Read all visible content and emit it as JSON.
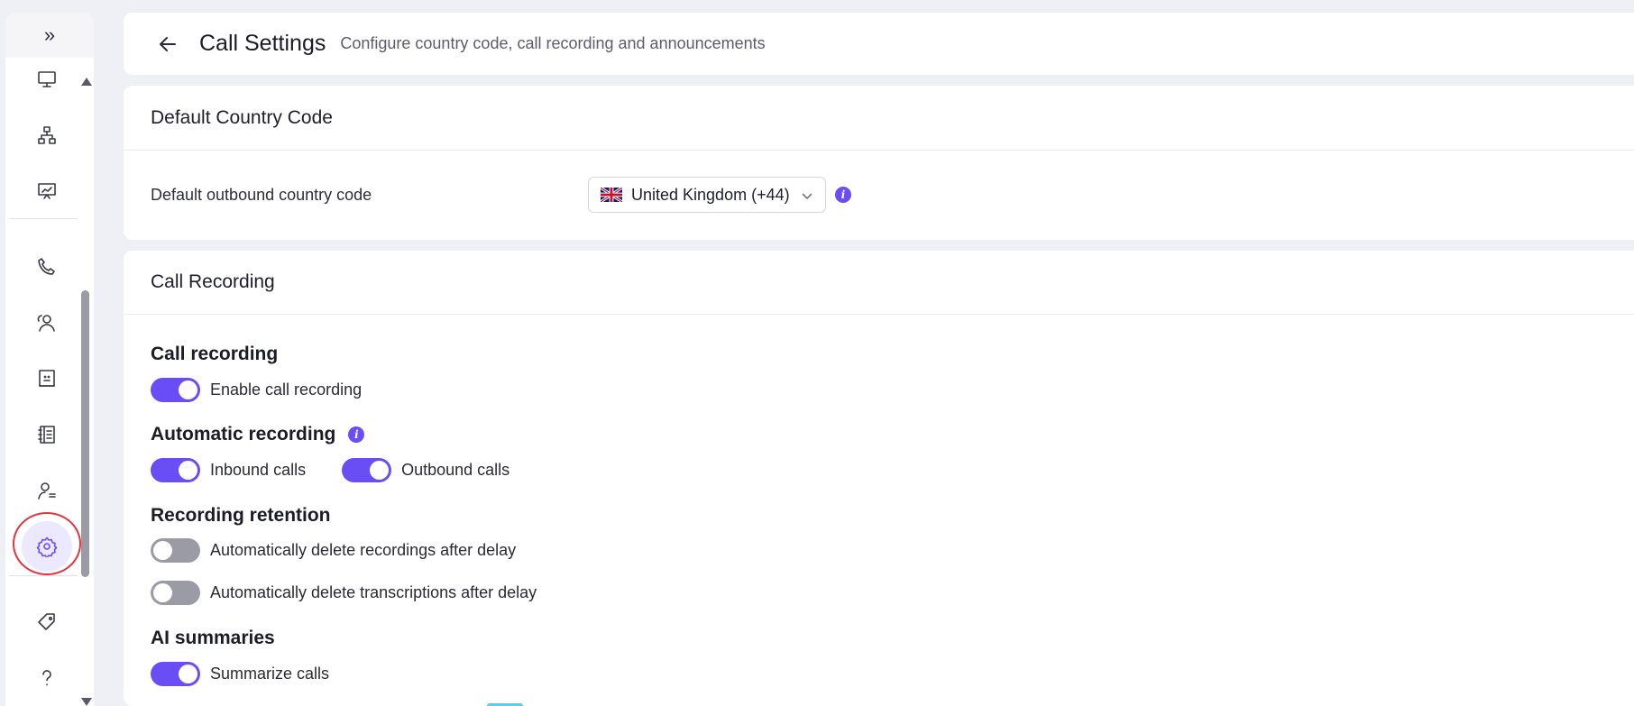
{
  "sidebar": {
    "expand_icon": "double-chevron-right-icon",
    "items": [
      {
        "name": "monitor",
        "icon": "monitor-icon"
      },
      {
        "name": "org-chart",
        "icon": "hierarchy-icon"
      },
      {
        "name": "analytics",
        "icon": "presentation-chart-icon"
      },
      {
        "name": "calls",
        "icon": "phone-icon"
      },
      {
        "name": "users",
        "icon": "users-icon"
      },
      {
        "name": "contacts",
        "icon": "contact-card-icon"
      },
      {
        "name": "directory",
        "icon": "directory-book-icon"
      },
      {
        "name": "user-settings",
        "icon": "user-settings-icon"
      },
      {
        "name": "settings",
        "icon": "gear-icon",
        "active": true
      },
      {
        "name": "tags",
        "icon": "tag-icon"
      },
      {
        "name": "help",
        "icon": "help-icon"
      }
    ]
  },
  "header": {
    "title": "Call Settings",
    "subtitle": "Configure country code, call recording and announcements"
  },
  "country_code": {
    "section_title": "Default Country Code",
    "label": "Default outbound country code",
    "selected": "United Kingdom (+44)"
  },
  "recording": {
    "section_title": "Call Recording",
    "call_recording": {
      "title": "Call recording",
      "enable_label": "Enable call recording",
      "enabled": true
    },
    "automatic": {
      "title": "Automatic recording",
      "inbound_label": "Inbound calls",
      "inbound": true,
      "outbound_label": "Outbound calls",
      "outbound": true
    },
    "retention": {
      "title": "Recording retention",
      "delete_recordings_label": "Automatically delete recordings after delay",
      "delete_recordings": false,
      "delete_transcriptions_label": "Automatically delete transcriptions after delay",
      "delete_transcriptions": false
    },
    "ai": {
      "title": "AI summaries",
      "summarize_label": "Summarize calls",
      "summarize": true
    }
  },
  "colors": {
    "accent": "#6a4ef5",
    "toggle_off": "#9b9ba5",
    "highlight_ring": "#e8323f"
  }
}
